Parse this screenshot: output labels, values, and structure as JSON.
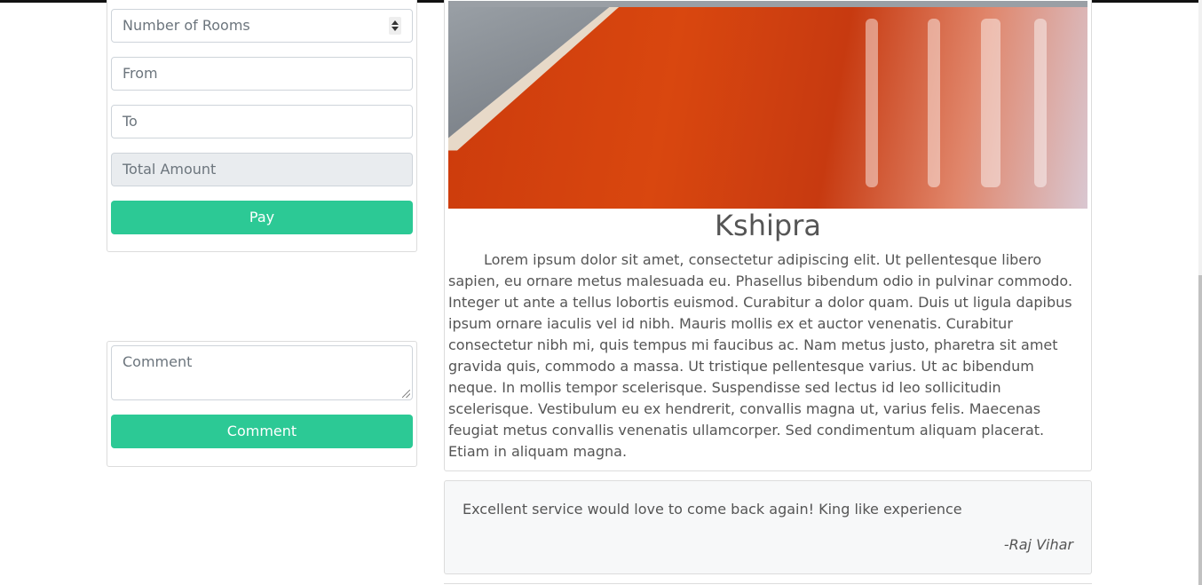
{
  "booking": {
    "rooms_placeholder": "Number of Rooms",
    "from_placeholder": "From",
    "to_placeholder": "To",
    "total_placeholder": "Total Amount",
    "pay_label": "Pay"
  },
  "comment_form": {
    "placeholder": "Comment",
    "button_label": "Comment"
  },
  "hotel": {
    "name": "Kshipra",
    "description": "Lorem ipsum dolor sit amet, consectetur adipiscing elit. Ut pellentesque libero sapien, eu ornare metus malesuada eu. Phasellus bibendum odio in pulvinar commodo. Integer ut ante a tellus lobortis euismod. Curabitur a dolor quam. Duis ut ligula dapibus ipsum ornare iaculis vel id nibh. Mauris mollis ex et auctor venenatis. Curabitur consectetur nibh mi, quis tempus mi faucibus ac. Nam metus justo, pharetra sit amet gravida quis, commodo a massa. Ut tristique pellentesque varius. Ut ac bibendum neque. In mollis tempor scelerisque. Suspendisse sed lectus id leo sollicitudin scelerisque. Vestibulum eu ex hendrerit, convallis magna ut, varius felis. Maecenas feugiat metus convallis venenatis ullamcorper. Sed condimentum aliquam placerat. Etiam in aliquam magna."
  },
  "reviews": [
    {
      "text": "Excellent service would love to come back again! King like experience",
      "author": "-Raj Vihar"
    }
  ],
  "colors": {
    "accent": "#2cc995",
    "border": "#dcdcdc",
    "text": "#555555"
  }
}
